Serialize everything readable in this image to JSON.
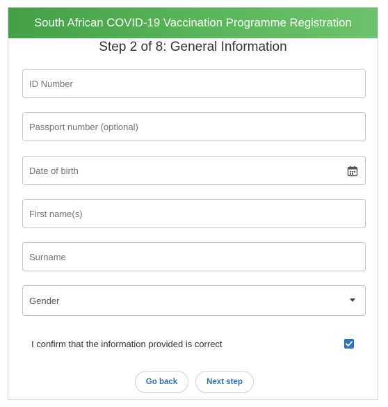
{
  "header": {
    "title": "South African COVID-19 Vaccination Programme Registration"
  },
  "step": {
    "title": "Step 2 of 8: General Information"
  },
  "fields": {
    "id_number": {
      "placeholder": "ID Number",
      "value": ""
    },
    "passport": {
      "placeholder": "Passport number (optional)",
      "value": ""
    },
    "dob": {
      "placeholder": "Date of birth",
      "value": "",
      "icon": "calendar-icon"
    },
    "first_name": {
      "placeholder": "First name(s)",
      "value": ""
    },
    "surname": {
      "placeholder": "Surname",
      "value": ""
    },
    "gender": {
      "label": "Gender",
      "icon": "chevron-down-icon"
    }
  },
  "confirm": {
    "label": "I confirm that the information provided is correct",
    "checked": true
  },
  "buttons": {
    "back": "Go back",
    "next": "Next step"
  },
  "colors": {
    "header_green": "#4caf50",
    "accent_blue": "#2f74c0",
    "button_text": "#2f6fb5"
  }
}
